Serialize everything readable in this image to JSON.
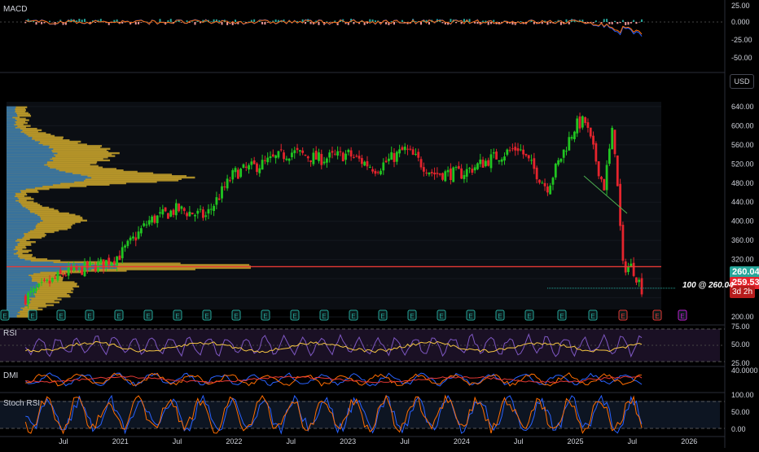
{
  "panels": {
    "macd": {
      "title": "MACD",
      "ticks": [
        "25.00",
        "0.000",
        "-25.00",
        "-50.00"
      ]
    },
    "main": {
      "currency": "USD",
      "ticks": [
        "640.00",
        "600.00",
        "560.00",
        "520.00",
        "480.00",
        "440.00",
        "400.00",
        "360.00",
        "320.00",
        "280.00",
        "240.00",
        "200.00"
      ]
    },
    "rsi": {
      "title": "RSI",
      "ticks": [
        "75.00",
        "50.00",
        "25.00"
      ]
    },
    "dmi": {
      "title": "DMI",
      "ticks": [
        "40.0000"
      ]
    },
    "stoch": {
      "title": "Stoch RSI",
      "ticks": [
        "100.00",
        "50.00",
        "0.00"
      ]
    }
  },
  "price_tags": {
    "last": "260.04",
    "current": "259.53",
    "countdown": "3d 2h"
  },
  "order_label": "100 @ 260.04",
  "earnings_marker": "E",
  "x_axis": [
    "Jul",
    "2021",
    "Jul",
    "2022",
    "Jul",
    "2023",
    "Jul",
    "2024",
    "Jul",
    "2025",
    "Jul",
    "2026"
  ],
  "colors": {
    "up": "#26a69a",
    "up_candle": "#21c521",
    "down": "#e5242d",
    "rsi": "#7e57c2",
    "macd": "#2962ff",
    "signal": "#ff6d00",
    "volume_profile": "#c5a12c",
    "vp_blue": "#2b6ea8",
    "hline": "#e53935"
  },
  "chart_data": {
    "type": "line",
    "title": "",
    "xlabel": "",
    "ylabel": "",
    "ylim": [
      195,
      650
    ],
    "x": [
      "2020-03",
      "2020-07",
      "2020-11",
      "2021-01",
      "2021-04",
      "2021-07",
      "2021-10",
      "2022-01",
      "2022-04",
      "2022-07",
      "2022-10",
      "2023-01",
      "2023-04",
      "2023-07",
      "2023-10",
      "2024-01",
      "2024-04",
      "2024-07",
      "2024-10",
      "2025-01",
      "2025-02",
      "2025-04",
      "2025-05",
      "2025-06",
      "2025-07",
      "2025-08"
    ],
    "series": [
      {
        "values": [
          240,
          290,
          310,
          330,
          400,
          425,
          410,
          500,
          520,
          545,
          530,
          540,
          510,
          550,
          500,
          500,
          530,
          555,
          470,
          600,
          610,
          470,
          600,
          305,
          305,
          260
        ]
      }
    ],
    "horizontal_line": 305,
    "annotation": "100 @ 260.04"
  }
}
